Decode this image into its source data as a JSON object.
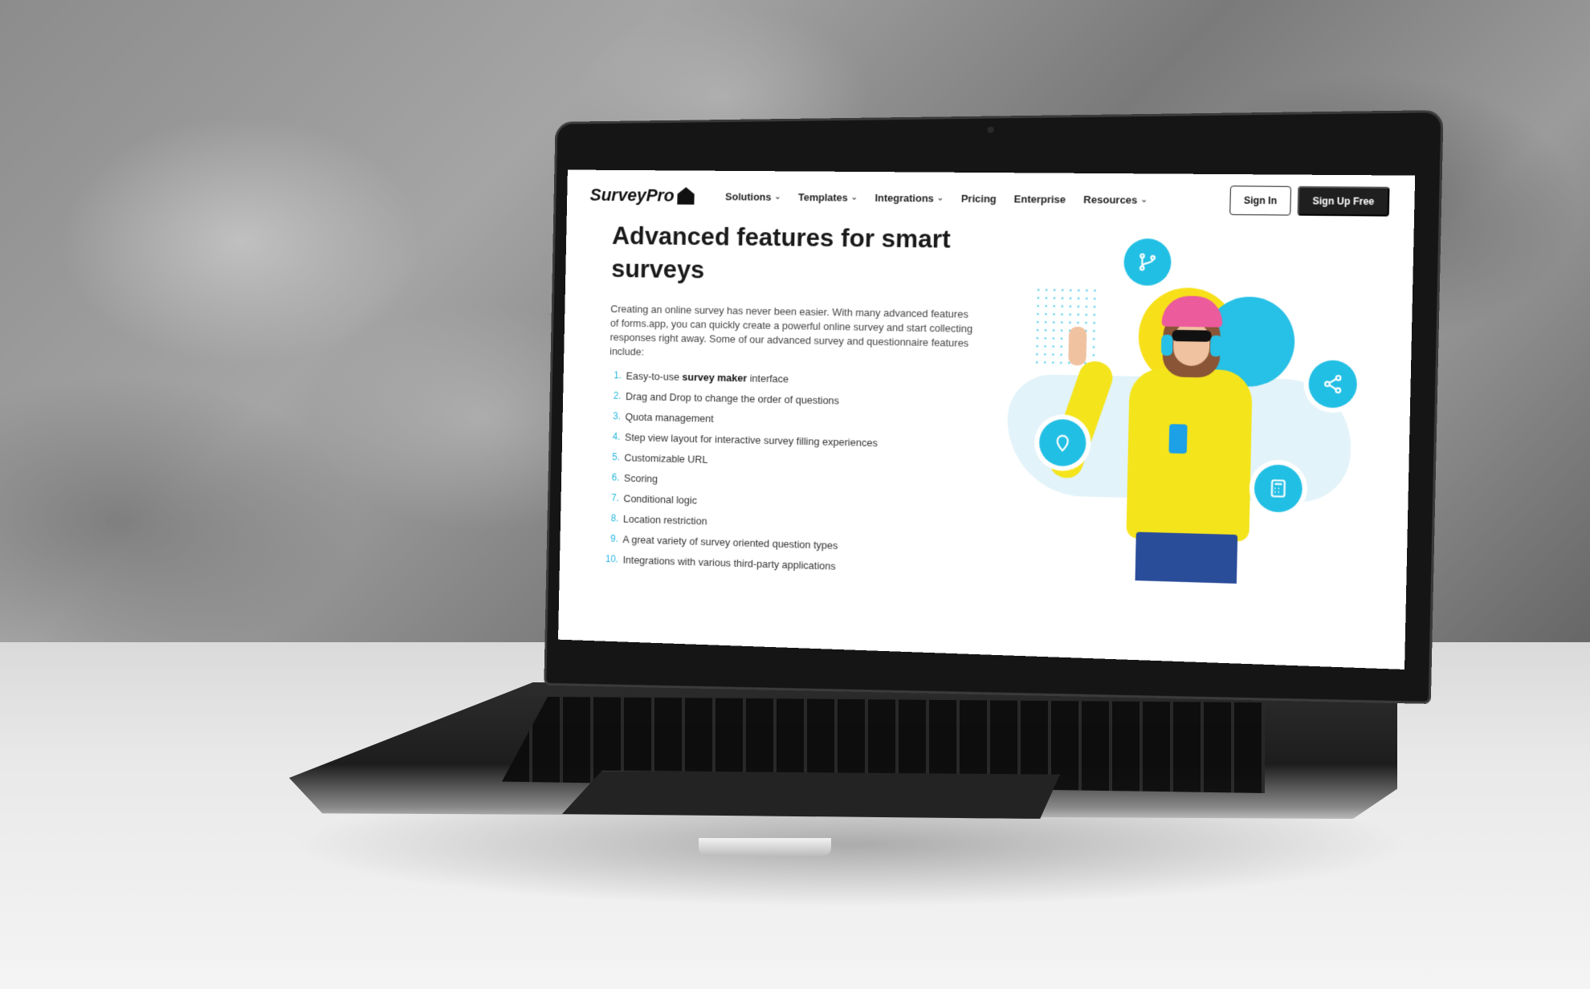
{
  "site": {
    "logo_text": "SurveyPro",
    "nav": {
      "items": [
        {
          "label": "Solutions",
          "has_dropdown": true
        },
        {
          "label": "Templates",
          "has_dropdown": true
        },
        {
          "label": "Integrations",
          "has_dropdown": true
        },
        {
          "label": "Pricing",
          "has_dropdown": false
        },
        {
          "label": "Enterprise",
          "has_dropdown": false
        },
        {
          "label": "Resources",
          "has_dropdown": true
        }
      ],
      "sign_in": "Sign In",
      "sign_up": "Sign Up Free"
    },
    "headline": "Advanced features for smart surveys",
    "intro": "Creating an online survey has never been easier. With many advanced features of forms.app, you can quickly create a powerful online survey and start collecting responses right away. Some of our advanced survey and questionnaire features include:",
    "features": [
      {
        "num": "1.",
        "pre": "Easy-to-use ",
        "bold": "survey maker",
        "post": " interface"
      },
      {
        "num": "2.",
        "pre": "Drag and Drop to change the order of questions",
        "bold": "",
        "post": ""
      },
      {
        "num": "3.",
        "pre": "Quota management",
        "bold": "",
        "post": ""
      },
      {
        "num": "4.",
        "pre": "Step view layout for interactive survey filling experiences",
        "bold": "",
        "post": ""
      },
      {
        "num": "5.",
        "pre": "Customizable URL",
        "bold": "",
        "post": ""
      },
      {
        "num": "6.",
        "pre": "Scoring",
        "bold": "",
        "post": ""
      },
      {
        "num": "7.",
        "pre": "Conditional logic",
        "bold": "",
        "post": ""
      },
      {
        "num": "8.",
        "pre": "Location restriction",
        "bold": "",
        "post": ""
      },
      {
        "num": "9.",
        "pre": "A great variety of survey oriented question types",
        "bold": "",
        "post": ""
      },
      {
        "num": "10.",
        "pre": "Integrations with various third-party applications",
        "bold": "",
        "post": ""
      }
    ],
    "illustration_icons": [
      "branch-icon",
      "share-icon",
      "location-pin-icon",
      "calculator-icon"
    ],
    "colors": {
      "accent": "#22bfe4",
      "yellow": "#f4e41c",
      "dark_button": "#1f1f1f"
    }
  }
}
